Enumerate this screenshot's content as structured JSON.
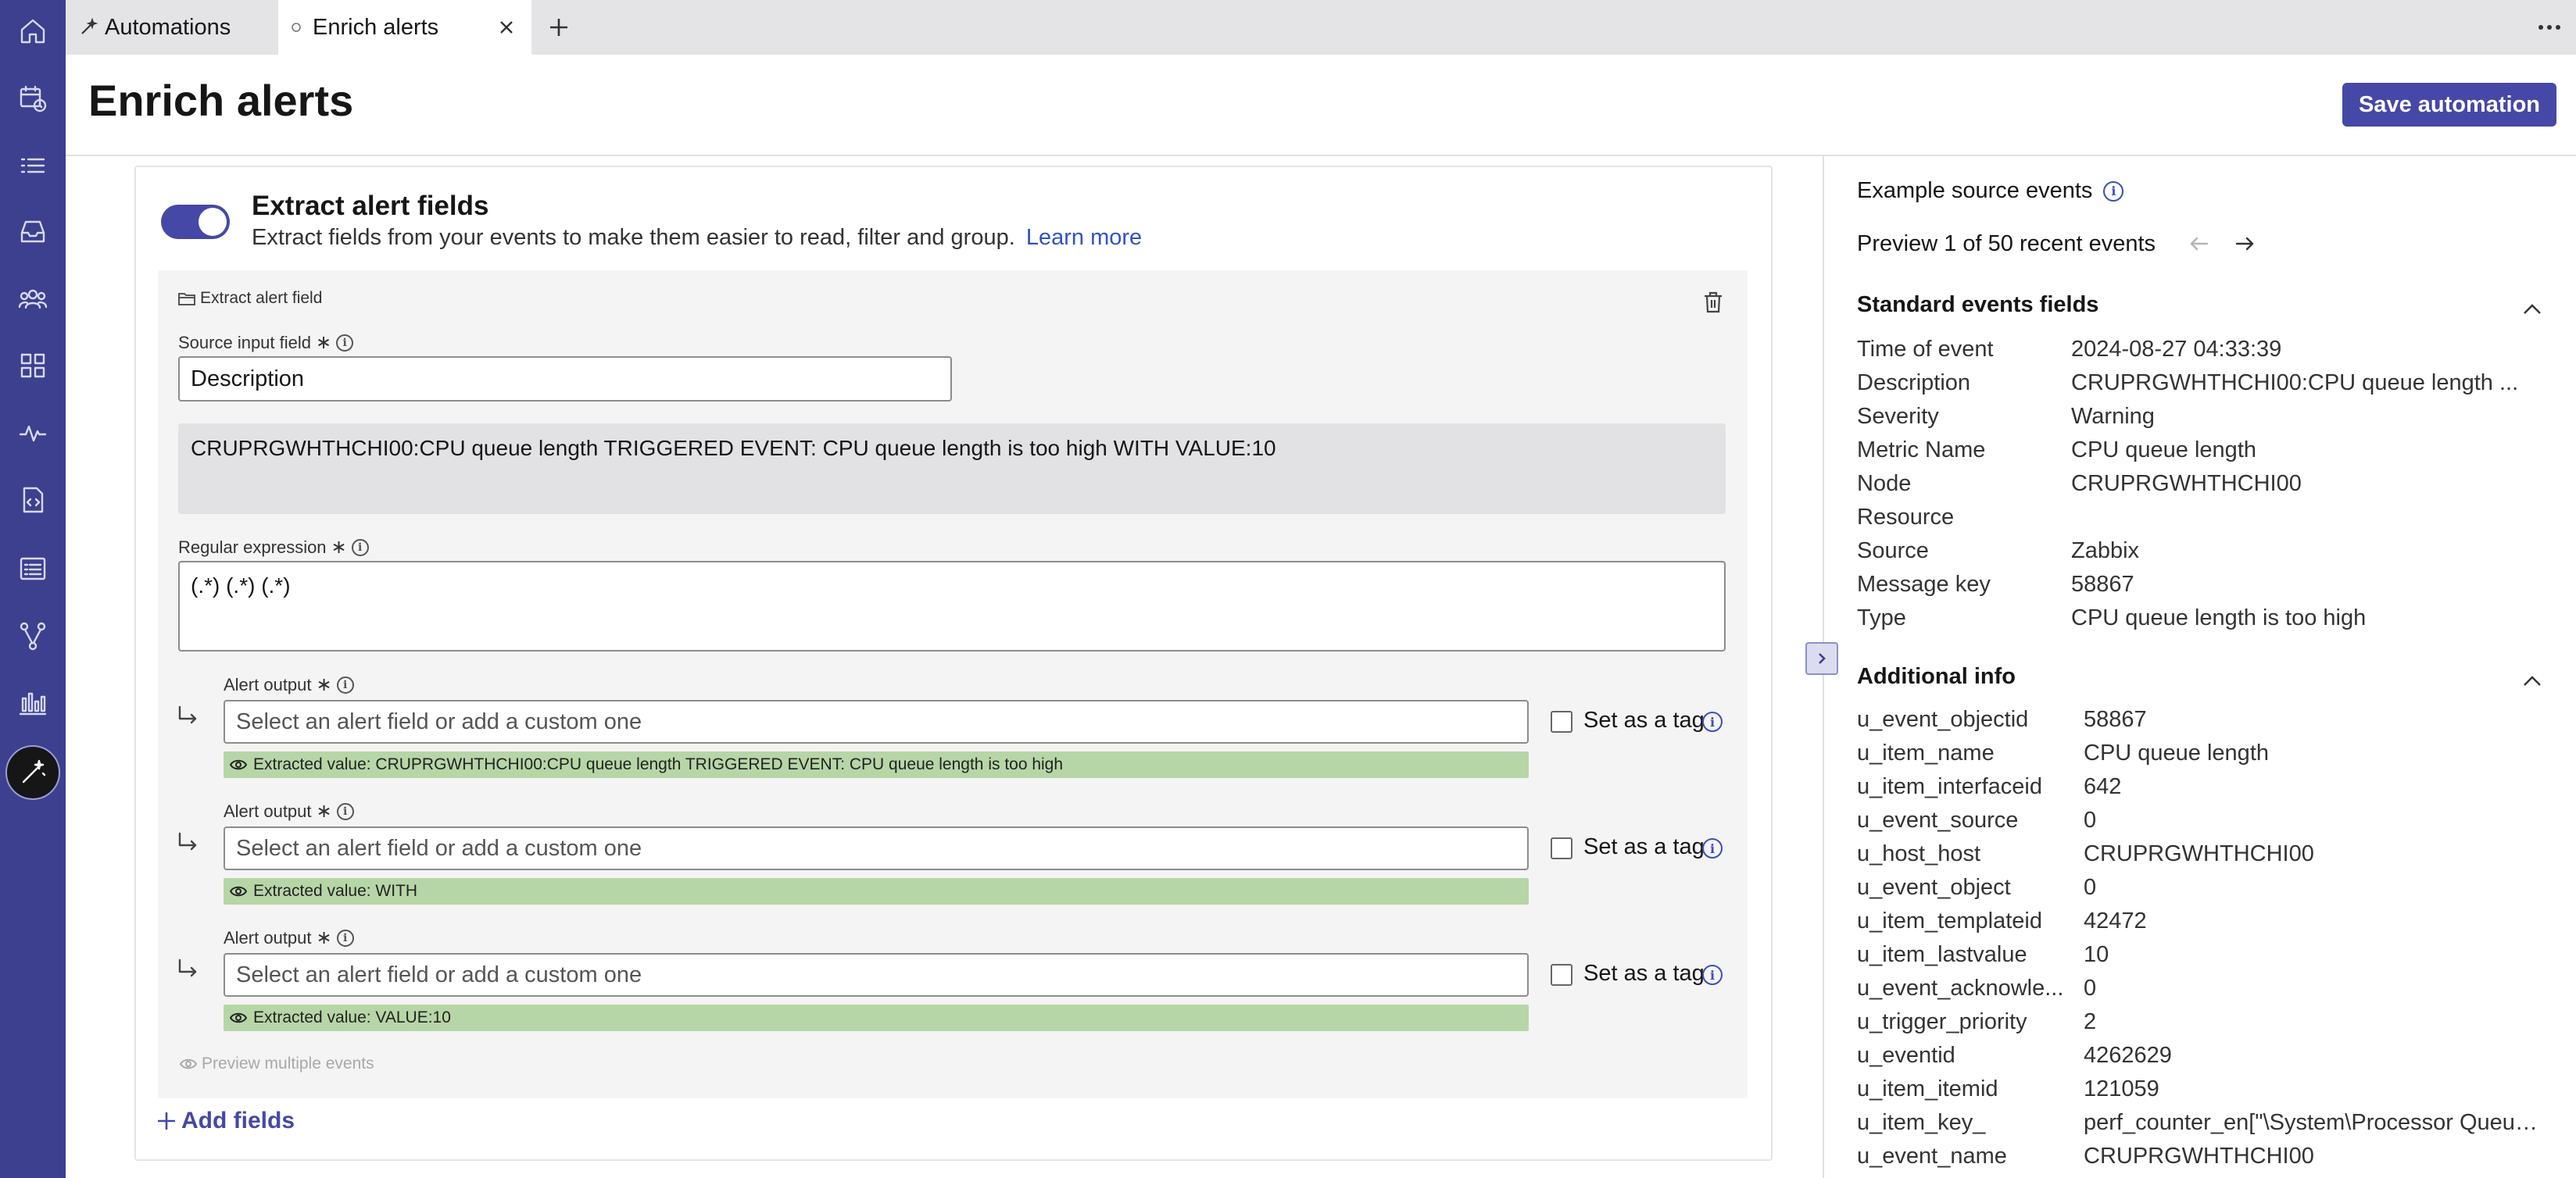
{
  "tabs": [
    {
      "label": "Automations",
      "icon": "wand-icon"
    },
    {
      "label": "Enrich alerts",
      "icon": "circle-icon"
    }
  ],
  "header": {
    "title": "Enrich alerts",
    "save_label": "Save automation"
  },
  "section": {
    "title": "Extract alert fields",
    "description": "Extract fields from your events to make them easier to read, filter and group.",
    "learn_more": "Learn more",
    "enabled": true
  },
  "extract_field": {
    "panel_label": "Extract alert field",
    "source_label": "Source input field",
    "source_value": "Description",
    "sample_text": "CRUPRGWHTHCHI00:CPU queue length TRIGGERED EVENT: CPU queue length is too high WITH VALUE:10",
    "regex_label": "Regular expression",
    "regex_value": "(.*) (.*) (.*)",
    "outputs": [
      {
        "label": "Alert output",
        "placeholder": "Select an alert field or add a custom one",
        "tag_label": "Set as a tag",
        "extracted": "Extracted value: CRUPRGWHTHCHI00:CPU queue length TRIGGERED EVENT: CPU queue length is too high"
      },
      {
        "label": "Alert output",
        "placeholder": "Select an alert field or add a custom one",
        "tag_label": "Set as a tag",
        "extracted": "Extracted value: WITH"
      },
      {
        "label": "Alert output",
        "placeholder": "Select an alert field or add a custom one",
        "tag_label": "Set as a tag",
        "extracted": "Extracted value: VALUE:10"
      }
    ],
    "preview_multiple": "Preview multiple events",
    "add_fields": "Add fields"
  },
  "right_panel": {
    "title": "Example source events",
    "preview": "Preview 1 of 50 recent events",
    "standard_title": "Standard events fields",
    "standard_fields": [
      {
        "key": "Time of event",
        "value": "2024-08-27 04:33:39"
      },
      {
        "key": "Description",
        "value": "CRUPRGWHTHCHI00:CPU queue length ..."
      },
      {
        "key": "Severity",
        "value": "Warning"
      },
      {
        "key": "Metric Name",
        "value": "CPU queue length"
      },
      {
        "key": "Node",
        "value": "CRUPRGWHTHCHI00"
      },
      {
        "key": "Resource",
        "value": ""
      },
      {
        "key": "Source",
        "value": "Zabbix"
      },
      {
        "key": "Message key",
        "value": "58867"
      },
      {
        "key": "Type",
        "value": "CPU queue length is too high"
      }
    ],
    "additional_title": "Additional info",
    "additional_fields": [
      {
        "key": "u_event_objectid",
        "value": "58867"
      },
      {
        "key": "u_item_name",
        "value": "CPU queue length"
      },
      {
        "key": "u_item_interfaceid",
        "value": "642"
      },
      {
        "key": "u_event_source",
        "value": "0"
      },
      {
        "key": "u_host_host",
        "value": "CRUPRGWHTHCHI00"
      },
      {
        "key": "u_event_object",
        "value": "0"
      },
      {
        "key": "u_item_templateid",
        "value": "42472"
      },
      {
        "key": "u_item_lastvalue",
        "value": "10"
      },
      {
        "key": "u_event_acknowle...",
        "value": "0"
      },
      {
        "key": "u_trigger_priority",
        "value": "2"
      },
      {
        "key": "u_eventid",
        "value": "4262629"
      },
      {
        "key": "u_item_itemid",
        "value": "121059"
      },
      {
        "key": "u_item_key_",
        "value": "perf_counter_en[\"\\System\\Processor Queue ..."
      },
      {
        "key": "u_event_name",
        "value": "CRUPRGWHTHCHI00"
      }
    ]
  },
  "colors": {
    "rail": "#3d3f8f",
    "primary": "#4548a6",
    "link": "#2f52c9",
    "extracted_bg": "#b7d6a7"
  }
}
